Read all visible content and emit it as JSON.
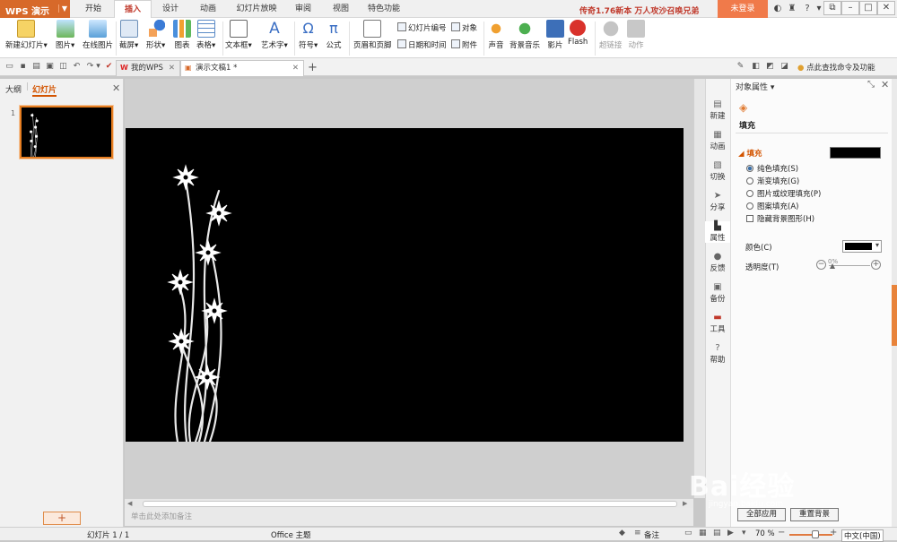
{
  "app": {
    "name": "WPS 演示",
    "dropdown_icon": "triangle-down"
  },
  "menu_tabs": [
    "开始",
    "插入",
    "设计",
    "动画",
    "幻灯片放映",
    "审阅",
    "视图",
    "特色功能"
  ],
  "active_menu_tab": "插入",
  "promo_text": "传奇1.76新本 万人攻沙召唤兄弟",
  "login_label": "未登录",
  "ribbon": {
    "new_slide": "新建幻灯片",
    "picture": "图片",
    "online_picture": "在线图片",
    "screenshot": "截屏",
    "shapes": "形状",
    "chart": "图表",
    "table": "表格",
    "textbox": "文本框",
    "wordart": "艺术字",
    "symbol": "符号",
    "formula": "公式",
    "header_footer": "页眉和页脚",
    "slide_number": "幻灯片编号",
    "object": "对象",
    "date_time": "日期和时间",
    "attachment": "附件",
    "sound": "声音",
    "bg_music": "背景音乐",
    "movie": "影片",
    "flash": "Flash",
    "hyperlink": "超链接",
    "action": "动作",
    "symbol_glyph": "Ω",
    "formula_glyph": "π",
    "wordart_glyph": "A"
  },
  "doc_tabs": [
    {
      "label": "我的WPS"
    },
    {
      "label": "演示文稿1 *"
    }
  ],
  "new_tab_glyph": "+",
  "search_hint": "点此查找命令及功能",
  "left_panel": {
    "tab_outline": "大纲",
    "tab_slides": "幻灯片",
    "slide_number": "1",
    "add_glyph": "+"
  },
  "notes_placeholder": "单击此处添加备注",
  "right_sidebar": [
    {
      "label": "新建",
      "icon": "new-icon"
    },
    {
      "label": "动画",
      "icon": "animation-icon"
    },
    {
      "label": "切换",
      "icon": "transition-icon"
    },
    {
      "label": "分享",
      "icon": "share-icon"
    },
    {
      "label": "属性",
      "icon": "property-icon"
    },
    {
      "label": "反馈",
      "icon": "feedback-icon"
    },
    {
      "label": "备份",
      "icon": "backup-icon"
    },
    {
      "label": "工具",
      "icon": "tools-icon"
    },
    {
      "label": "帮助",
      "icon": "help-icon"
    }
  ],
  "properties_panel": {
    "title": "对象属性",
    "tab_fill": "填充",
    "section_fill": "填充",
    "fill_options": [
      "纯色填充(S)",
      "渐变填充(G)",
      "图片或纹理填充(P)",
      "图案填充(A)"
    ],
    "selected_fill": "纯色填充(S)",
    "hide_bg": "隐藏背景图形(H)",
    "color_label": "颜色(C)",
    "transparency_label": "透明度(T)",
    "transparency_value": "0%",
    "apply_all": "全部应用",
    "reset_bg": "重置背景",
    "fill_color": "#000000"
  },
  "status": {
    "slide_indicator": "幻灯片 1 / 1",
    "theme": "Office 主题",
    "notes": "备注",
    "zoom": "70 %",
    "language": "中文(中国)"
  },
  "colors": {
    "accent": "#d7692a",
    "active_tab_text": "#c0392b",
    "slide_bg": "#000000"
  },
  "watermark": {
    "brand": "Bai经验",
    "url": "jingyan.baidu.com"
  }
}
